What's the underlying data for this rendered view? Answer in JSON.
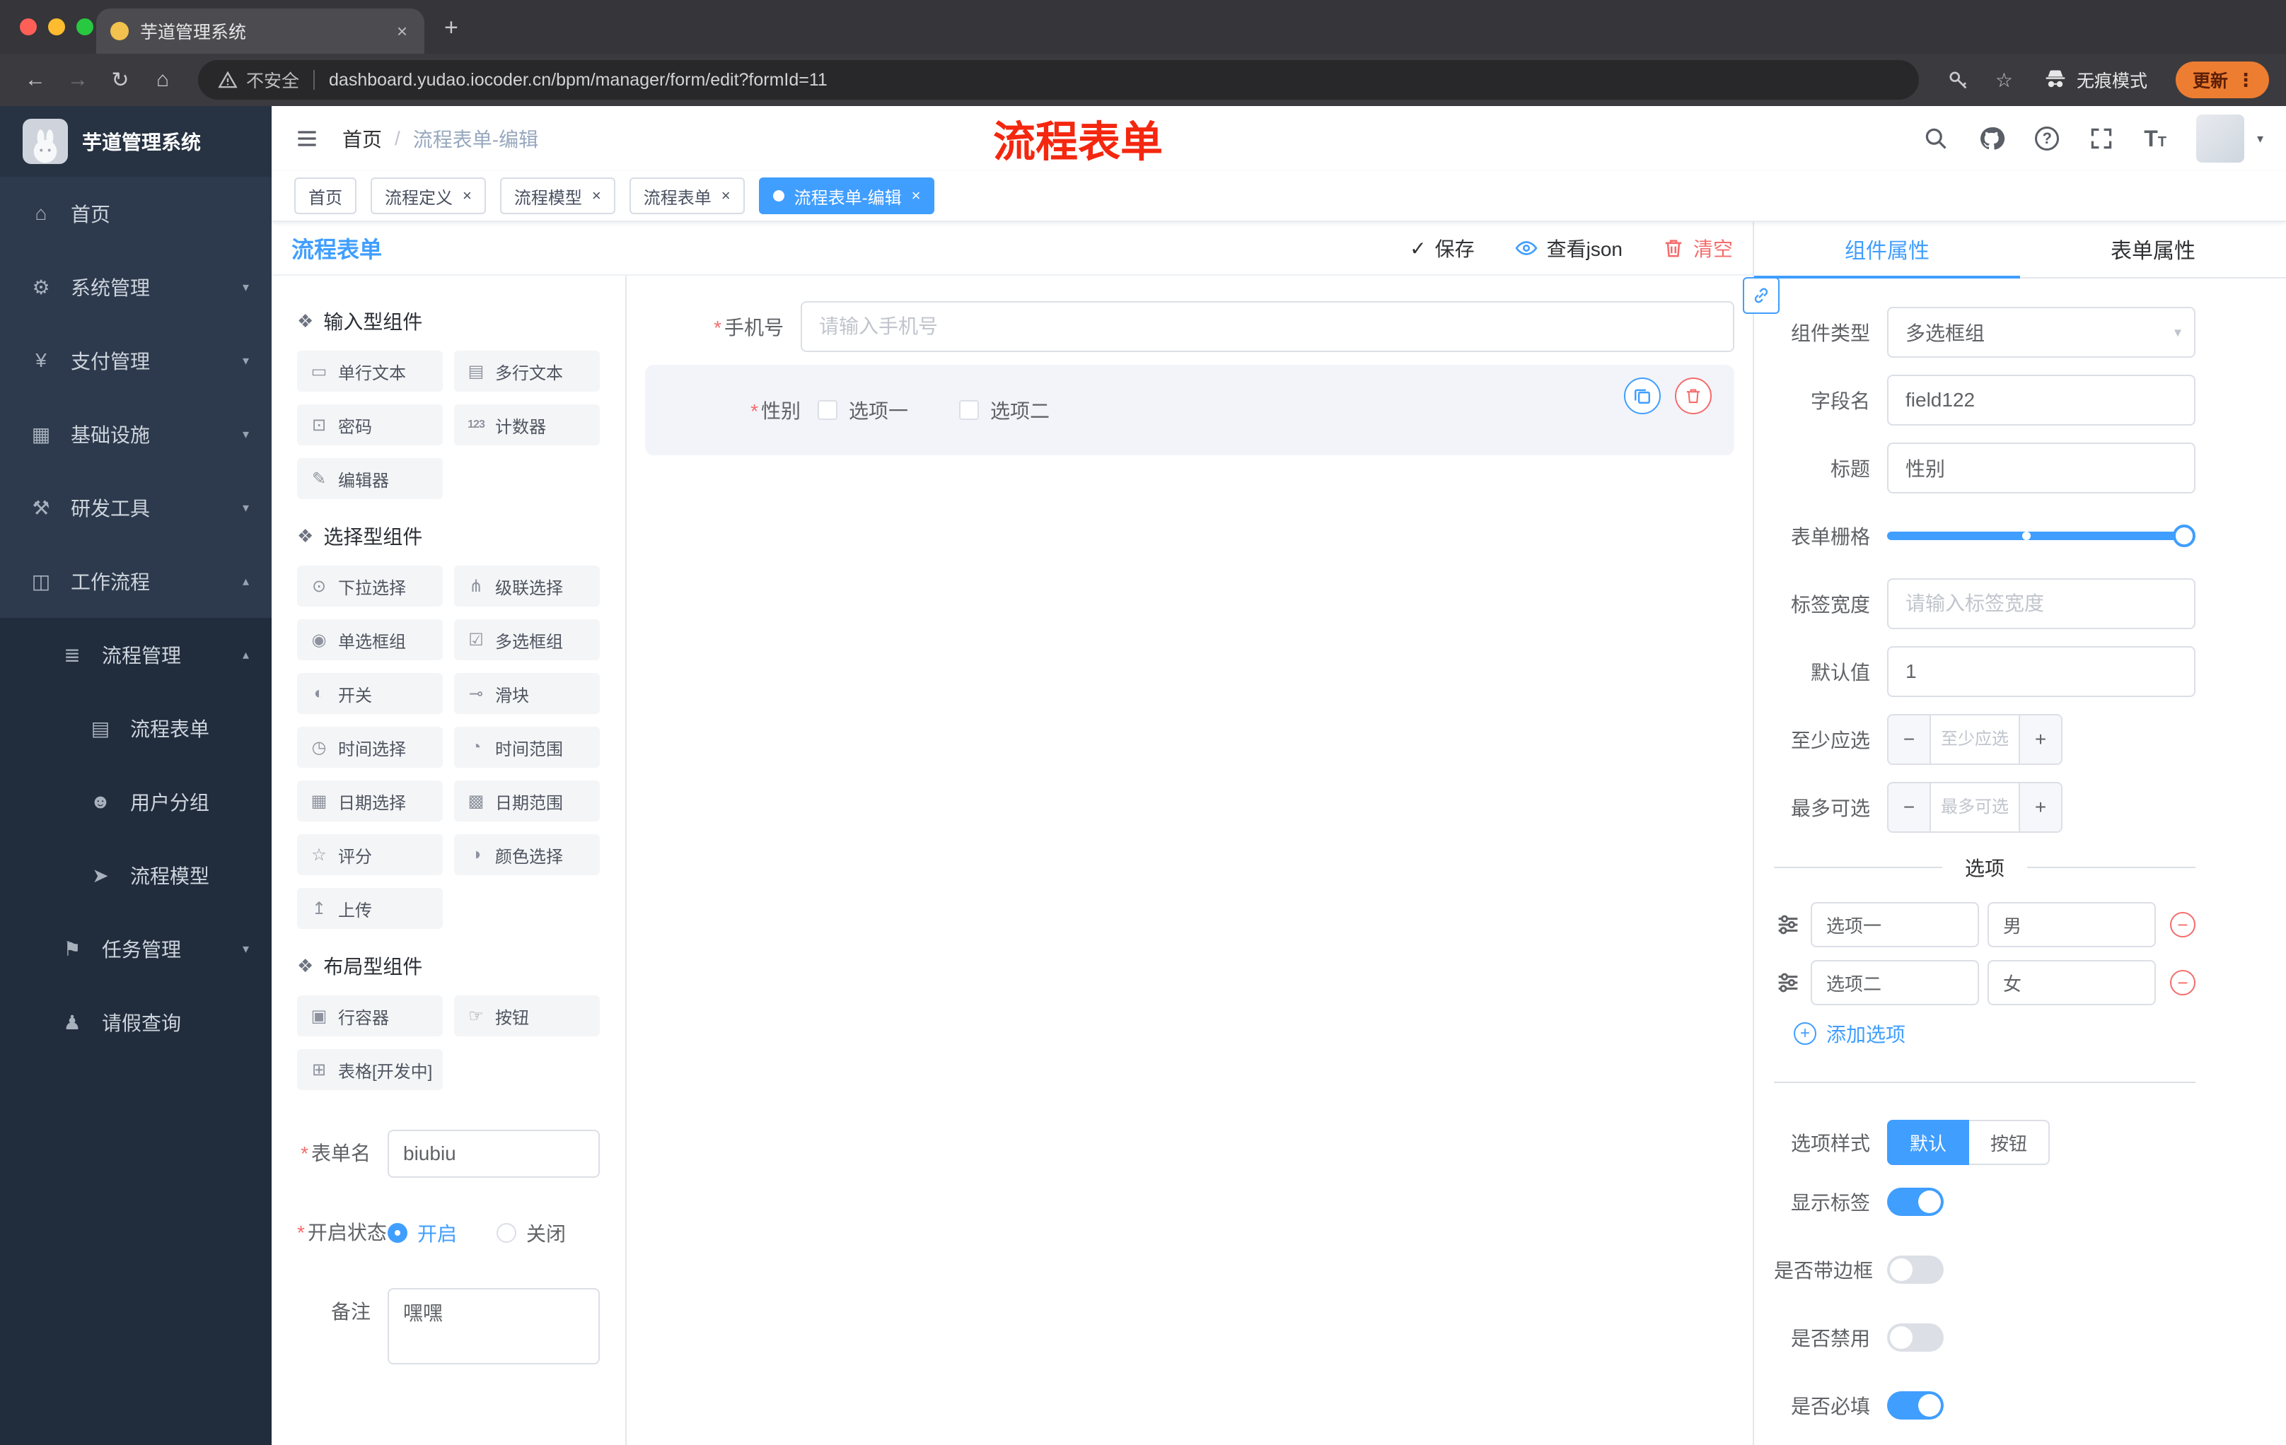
{
  "colors": {
    "accent": "#409eff",
    "danger": "#f56c6c",
    "sidebar": "#2d3a4d",
    "annotation_red": "#f4270f",
    "update_orange": "#ed7d31"
  },
  "browser": {
    "tab": {
      "title": "芋道管理系统"
    },
    "nav": {
      "back": "←",
      "forward": "→",
      "reload": "↻",
      "home": "⌂"
    },
    "address": {
      "security": "不安全",
      "url": "dashboard.yudao.iocoder.cn/bpm/manager/form/edit?formId=11"
    },
    "incognito": "无痕模式",
    "update": "更新"
  },
  "sidebar": {
    "title": "芋道管理系统",
    "items": [
      {
        "key": "home",
        "label": "首页",
        "glyph": "⌂",
        "level": 1
      },
      {
        "key": "system-management",
        "label": "系统管理",
        "glyph": "⚙",
        "level": 1,
        "chevron": "down"
      },
      {
        "key": "payment-management",
        "label": "支付管理",
        "glyph": "¥",
        "level": 1,
        "chevron": "down"
      },
      {
        "key": "infrastructure",
        "label": "基础设施",
        "glyph": "▦",
        "level": 1,
        "chevron": "down"
      },
      {
        "key": "dev-tools",
        "label": "研发工具",
        "glyph": "⚒",
        "level": 1,
        "chevron": "down"
      },
      {
        "key": "workflow",
        "label": "工作流程",
        "glyph": "◫",
        "level": 1,
        "chevron": "up"
      },
      {
        "key": "process-management",
        "label": "流程管理",
        "glyph": "≣",
        "level": 2,
        "chevron": "up",
        "sub": true
      },
      {
        "key": "process-form",
        "label": "流程表单",
        "glyph": "▤",
        "level": 3,
        "sub": true
      },
      {
        "key": "user-group",
        "label": "用户分组",
        "glyph": "☻",
        "level": 3,
        "sub": true
      },
      {
        "key": "process-model",
        "label": "流程模型",
        "glyph": "➤",
        "level": 3,
        "sub": true
      },
      {
        "key": "task-management",
        "label": "任务管理",
        "glyph": "⚑",
        "level": 2,
        "chevron": "down",
        "sub": true
      },
      {
        "key": "leave-query",
        "label": "请假查询",
        "glyph": "♟",
        "level": 2,
        "sub": true
      }
    ]
  },
  "header": {
    "breadcrumb": [
      "首页",
      "流程表单-编辑"
    ],
    "annotation": "流程表单"
  },
  "tags": [
    {
      "key": "home",
      "label": "首页",
      "closable": false,
      "active": false
    },
    {
      "key": "process-definition",
      "label": "流程定义",
      "closable": true,
      "active": false
    },
    {
      "key": "process-model",
      "label": "流程模型",
      "closable": true,
      "active": false
    },
    {
      "key": "process-form",
      "label": "流程表单",
      "closable": true,
      "active": false
    },
    {
      "key": "process-form-edit",
      "label": "流程表单-编辑",
      "closable": true,
      "active": true
    }
  ],
  "workspace": {
    "title": "流程表单",
    "actions": {
      "save": "保存",
      "view_json": "查看json",
      "clear": "清空"
    }
  },
  "palette": {
    "groups": [
      {
        "title": "输入型组件",
        "items": [
          {
            "label": "单行文本",
            "glyph": "▭"
          },
          {
            "label": "多行文本",
            "glyph": "▤"
          },
          {
            "label": "密码",
            "glyph": "⊡"
          },
          {
            "label": "计数器",
            "glyph": "123"
          },
          {
            "label": "编辑器",
            "glyph": "✎"
          }
        ]
      },
      {
        "title": "选择型组件",
        "items": [
          {
            "label": "下拉选择",
            "glyph": "⊙"
          },
          {
            "label": "级联选择",
            "glyph": "⋔"
          },
          {
            "label": "单选框组",
            "glyph": "◉"
          },
          {
            "label": "多选框组",
            "glyph": "☑"
          },
          {
            "label": "开关",
            "glyph": "◐"
          },
          {
            "label": "滑块",
            "glyph": "⊸"
          },
          {
            "label": "时间选择",
            "glyph": "◷"
          },
          {
            "label": "时间范围",
            "glyph": "◔"
          },
          {
            "label": "日期选择",
            "glyph": "▦"
          },
          {
            "label": "日期范围",
            "glyph": "▩"
          },
          {
            "label": "评分",
            "glyph": "☆"
          },
          {
            "label": "颜色选择",
            "glyph": "◑"
          },
          {
            "label": "上传",
            "glyph": "↥"
          }
        ]
      },
      {
        "title": "布局型组件",
        "items": [
          {
            "label": "行容器",
            "glyph": "▣"
          },
          {
            "label": "按钮",
            "glyph": "☞"
          },
          {
            "label": "表格[开发中]",
            "glyph": "⊞"
          }
        ]
      }
    ],
    "form": {
      "name_label": "表单名",
      "name_value": "biubiu",
      "status_label": "开启状态",
      "status_options": [
        {
          "label": "开启",
          "selected": true
        },
        {
          "label": "关闭",
          "selected": false
        }
      ],
      "remark_label": "备注",
      "remark_value": "嘿嘿"
    }
  },
  "canvas": {
    "phone": {
      "label": "手机号",
      "placeholder": "请输入手机号",
      "required": true
    },
    "gender": {
      "label": "性别",
      "required": true,
      "options": [
        "选项一",
        "选项二"
      ]
    }
  },
  "props": {
    "tabs": [
      {
        "label": "组件属性",
        "active": true
      },
      {
        "label": "表单属性",
        "active": false
      }
    ],
    "component_type": {
      "label": "组件类型",
      "value": "多选框组"
    },
    "field_name": {
      "label": "字段名",
      "value": "field122"
    },
    "title": {
      "label": "标题",
      "value": "性别"
    },
    "grid": {
      "label": "表单栅格"
    },
    "label_width": {
      "label": "标签宽度",
      "placeholder": "请输入标签宽度"
    },
    "default_value": {
      "label": "默认值",
      "value": "1"
    },
    "min_select": {
      "label": "至少应选",
      "placeholder": "至少应选"
    },
    "max_select": {
      "label": "最多可选",
      "placeholder": "最多可选"
    },
    "options": {
      "divider": "选项",
      "rows": [
        {
          "name": "选项一",
          "value": "男"
        },
        {
          "name": "选项二",
          "value": "女"
        }
      ],
      "add": "添加选项"
    },
    "option_style": {
      "label": "选项样式",
      "choices": [
        {
          "label": "默认",
          "active": true
        },
        {
          "label": "按钮",
          "active": false
        }
      ]
    },
    "switches": [
      {
        "label": "显示标签",
        "on": true
      },
      {
        "label": "是否带边框",
        "on": false
      },
      {
        "label": "是否禁用",
        "on": false
      },
      {
        "label": "是否必填",
        "on": true
      }
    ]
  }
}
